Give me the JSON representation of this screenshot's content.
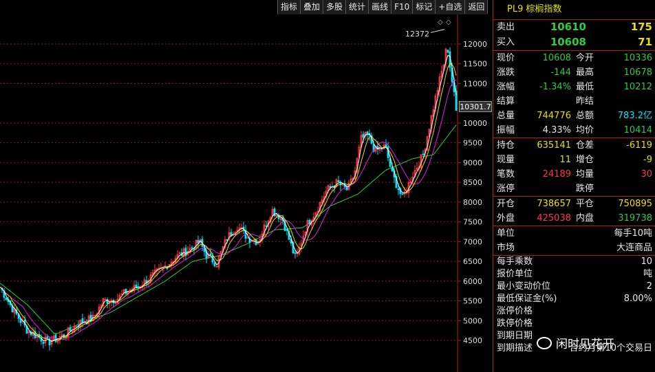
{
  "toolbar": {
    "items": [
      "指标",
      "叠加",
      "多股",
      "统计",
      "画线",
      "F10",
      "标记",
      "+自选",
      "返回"
    ]
  },
  "chart": {
    "current_price_tag": "10301.7",
    "peak_label": "12372",
    "marker_icon": "diamond-icon",
    "y_ticks": [
      "12000",
      "11500",
      "11000",
      "10000",
      "9500",
      "9000",
      "8500",
      "8000",
      "7500",
      "7000",
      "6500",
      "6000",
      "5500",
      "5000",
      "4500"
    ],
    "colors": {
      "up": "#ff3b3b",
      "down": "#00e5ff",
      "ma_white": "#ffffff",
      "ma_yellow": "#e8e000",
      "ma_magenta": "#e020e0",
      "ma_green": "#2ecc40",
      "grid": "#8b1a1a"
    }
  },
  "chart_data": {
    "type": "candlestick",
    "ylim": [
      4200,
      12700
    ],
    "ticks": [
      12000,
      11500,
      11000,
      10000,
      9500,
      9000,
      8500,
      8000,
      7500,
      7000,
      6500,
      6000,
      5500,
      5000,
      4500
    ],
    "anchors": [
      [
        0,
        5850
      ],
      [
        20,
        5250
      ],
      [
        40,
        4750
      ],
      [
        70,
        4450
      ],
      [
        95,
        4650
      ],
      [
        115,
        4950
      ],
      [
        135,
        5050
      ],
      [
        150,
        5500
      ],
      [
        170,
        5550
      ],
      [
        185,
        5750
      ],
      [
        200,
        5850
      ],
      [
        215,
        6050
      ],
      [
        235,
        6300
      ],
      [
        255,
        6600
      ],
      [
        275,
        6800
      ],
      [
        290,
        7000
      ],
      [
        300,
        6650
      ],
      [
        315,
        6450
      ],
      [
        330,
        7100
      ],
      [
        345,
        7400
      ],
      [
        360,
        7100
      ],
      [
        375,
        7000
      ],
      [
        395,
        7800
      ],
      [
        410,
        7600
      ],
      [
        425,
        6800
      ],
      [
        430,
        6550
      ],
      [
        445,
        7400
      ],
      [
        460,
        7800
      ],
      [
        475,
        8300
      ],
      [
        490,
        8500
      ],
      [
        505,
        8300
      ],
      [
        515,
        8700
      ],
      [
        525,
        9600
      ],
      [
        535,
        9700
      ],
      [
        545,
        9300
      ],
      [
        560,
        9400
      ],
      [
        570,
        8700
      ],
      [
        585,
        8100
      ],
      [
        600,
        8700
      ],
      [
        615,
        9200
      ],
      [
        625,
        10000
      ],
      [
        635,
        10800
      ],
      [
        645,
        11500
      ],
      [
        650,
        12000
      ],
      [
        655,
        11300
      ],
      [
        660,
        10700
      ],
      [
        663,
        10302
      ]
    ],
    "ma_green_anchors": [
      [
        0,
        5950
      ],
      [
        40,
        5400
      ],
      [
        80,
        4650
      ],
      [
        120,
        4950
      ],
      [
        160,
        5200
      ],
      [
        200,
        5600
      ],
      [
        240,
        6000
      ],
      [
        280,
        6500
      ],
      [
        320,
        6650
      ],
      [
        360,
        6950
      ],
      [
        400,
        7300
      ],
      [
        440,
        7350
      ],
      [
        480,
        7900
      ],
      [
        520,
        8200
      ],
      [
        560,
        8800
      ],
      [
        600,
        9100
      ],
      [
        630,
        9200
      ],
      [
        663,
        9950
      ]
    ]
  },
  "panel": {
    "title": "PL9 棕榈指数",
    "quote": [
      {
        "label": "卖出",
        "price": "10610",
        "vol": "175"
      },
      {
        "label": "买入",
        "price": "10608",
        "vol": "71"
      }
    ],
    "stats": [
      {
        "l1": "现价",
        "v1": "10608",
        "c1": "green",
        "l2": "今开",
        "v2": "10336",
        "c2": "green"
      },
      {
        "l1": "涨跌",
        "v1": "-144",
        "c1": "green",
        "l2": "最高",
        "v2": "10678",
        "c2": "green"
      },
      {
        "l1": "涨幅",
        "v1": "-1.34%",
        "c1": "green",
        "l2": "最低",
        "v2": "10212",
        "c2": "green"
      },
      {
        "l1": "结算",
        "v1": "",
        "c1": "white",
        "l2": "昨结",
        "v2": "",
        "c2": "white"
      },
      {
        "l1": "总量",
        "v1": "744776",
        "c1": "yellow",
        "l2": "总额",
        "v2": "783.2亿",
        "c2": "cyan"
      },
      {
        "l1": "振幅",
        "v1": "4.33%",
        "c1": "white",
        "l2": "均价",
        "v2": "10414",
        "c2": "green"
      }
    ],
    "stats2": [
      {
        "l1": "持仓",
        "v1": "635141",
        "c1": "yellow",
        "l2": "仓差",
        "v2": "-6119",
        "c2": "yellow"
      },
      {
        "l1": "现量",
        "v1": "11",
        "c1": "yellow",
        "l2": "增仓",
        "v2": "-9",
        "c2": "yellow"
      },
      {
        "l1": "笔数",
        "v1": "24189",
        "c1": "red",
        "l2": "均量",
        "v2": "30",
        "c2": "red"
      },
      {
        "l1": "涨停",
        "v1": "",
        "c1": "white",
        "l2": "跌停",
        "v2": "",
        "c2": "white"
      }
    ],
    "stats3": [
      {
        "l1": "开仓",
        "v1": "738657",
        "c1": "yellow",
        "l2": "平仓",
        "v2": "750895",
        "c2": "yellow"
      },
      {
        "l1": "外盘",
        "v1": "425038",
        "c1": "red",
        "l2": "内盘",
        "v2": "319738",
        "c2": "green"
      }
    ],
    "info1": [
      {
        "label": "单位",
        "value": "每手10吨"
      },
      {
        "label": "市场",
        "value": "大连商品"
      }
    ],
    "info2": [
      {
        "label": "每手乘数",
        "value": "10"
      },
      {
        "label": "报价单位",
        "value": "吨"
      },
      {
        "label": "最小变动价位",
        "value": "2"
      },
      {
        "label": "最低保证金(%)",
        "value": "8.00%"
      },
      {
        "label": "涨停价格",
        "value": ""
      },
      {
        "label": "跌停价格",
        "value": ""
      },
      {
        "label": "到期日期",
        "value": ""
      },
      {
        "label": "到期描述",
        "value": "合约月第10个交易日"
      }
    ]
  },
  "watermark": {
    "text": "闲时见花开",
    "icon": "wechat-icon"
  }
}
